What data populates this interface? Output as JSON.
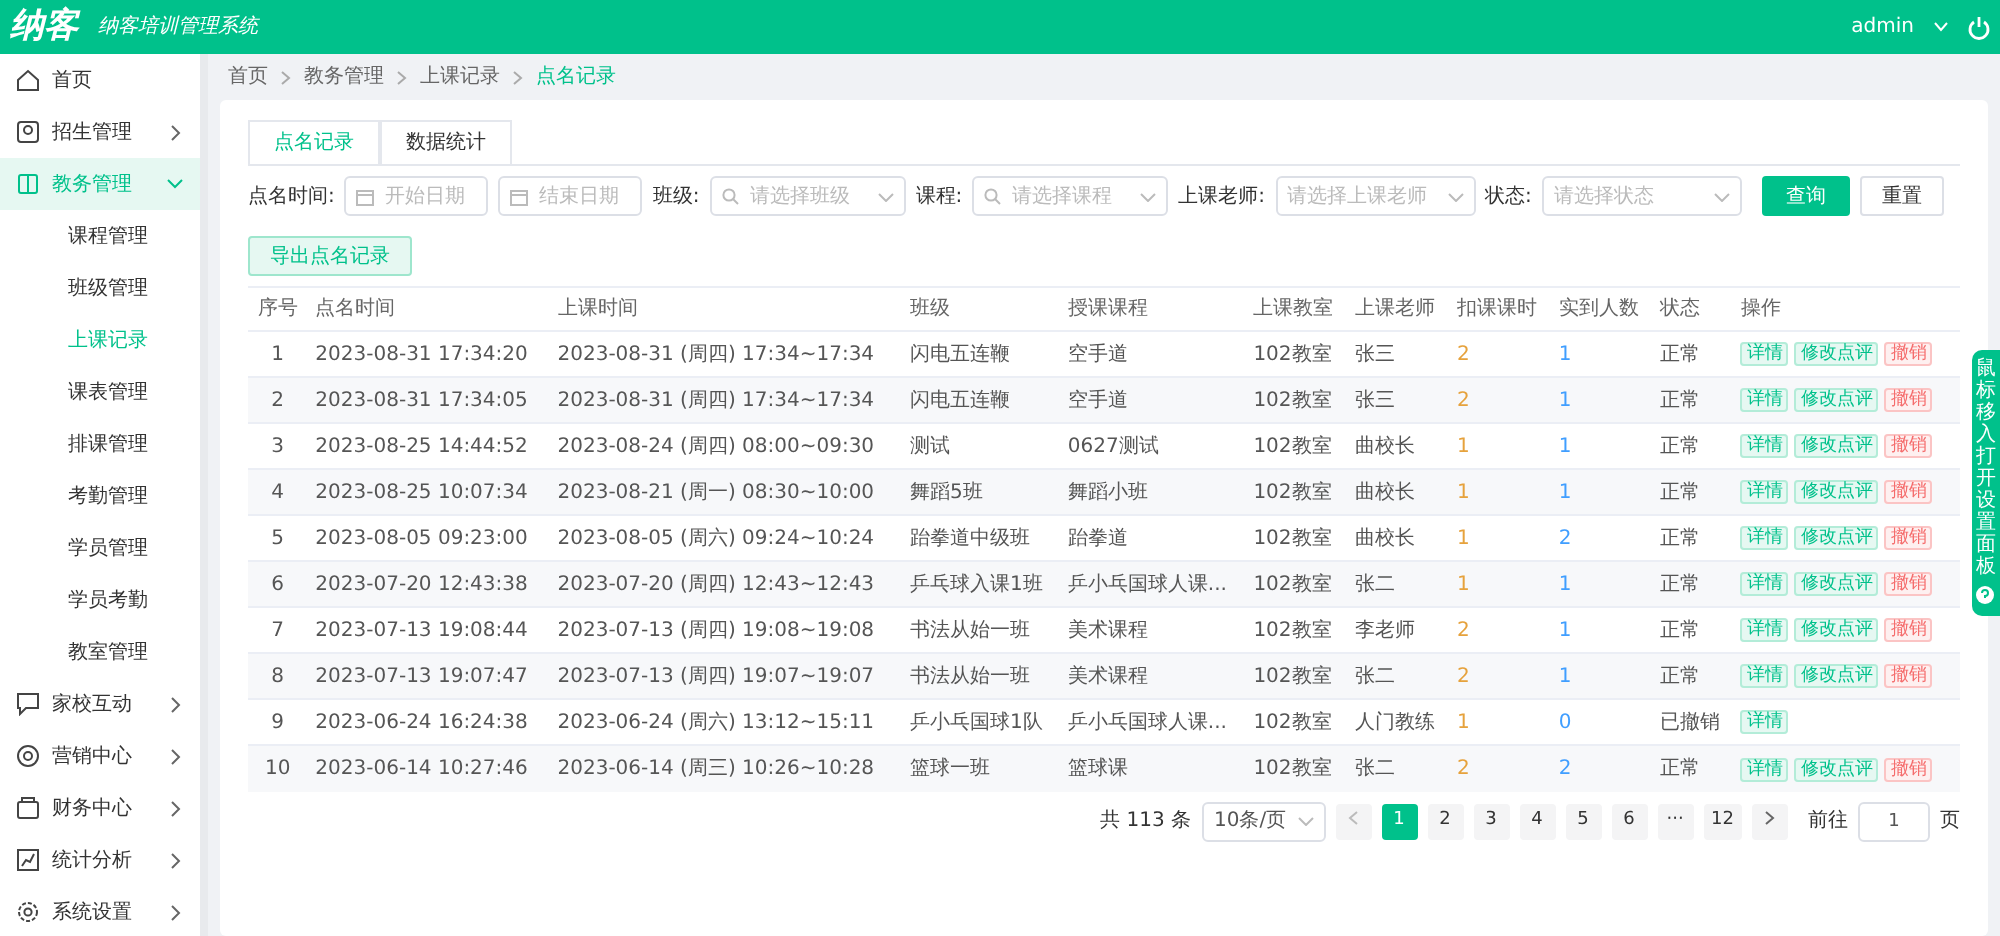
{
  "header": {
    "logo": "纳客",
    "slogan": "纳客培训管理系统",
    "user": "admin"
  },
  "sidebar": {
    "items": [
      {
        "label": "首页",
        "kind": "link"
      },
      {
        "label": "招生管理",
        "kind": "group",
        "expanded": false
      },
      {
        "label": "教务管理",
        "kind": "group",
        "expanded": true,
        "selected": true,
        "children": [
          {
            "label": "课程管理",
            "selected": false
          },
          {
            "label": "班级管理",
            "selected": false
          },
          {
            "label": "上课记录",
            "selected": true
          },
          {
            "label": "课表管理",
            "selected": false
          },
          {
            "label": "排课管理",
            "selected": false
          },
          {
            "label": "考勤管理",
            "selected": false
          },
          {
            "label": "学员管理",
            "selected": false
          },
          {
            "label": "学员考勤",
            "selected": false
          },
          {
            "label": "教室管理",
            "selected": false
          }
        ]
      },
      {
        "label": "家校互动",
        "kind": "group",
        "expanded": false
      },
      {
        "label": "营销中心",
        "kind": "group",
        "expanded": false
      },
      {
        "label": "财务中心",
        "kind": "group",
        "expanded": false
      },
      {
        "label": "统计分析",
        "kind": "group",
        "expanded": false
      },
      {
        "label": "系统设置",
        "kind": "group",
        "expanded": false
      }
    ]
  },
  "breadcrumb": [
    "首页",
    "教务管理",
    "上课记录",
    "点名记录"
  ],
  "tabs": [
    {
      "label": "点名记录",
      "selected": true
    },
    {
      "label": "数据统计",
      "selected": false
    }
  ],
  "filters": [
    {
      "label": "点名时间:",
      "kind": "date",
      "placeholders": [
        "开始日期",
        "结束日期"
      ]
    },
    {
      "label": "班级:",
      "kind": "search_select",
      "placeholder": "请选择班级"
    },
    {
      "label": "课程:",
      "kind": "search_select",
      "placeholder": "请选择课程"
    },
    {
      "label": "上课老师:",
      "kind": "select",
      "placeholder": "请选择上课老师"
    },
    {
      "label": "状态:",
      "kind": "select",
      "placeholder": "请选择状态"
    }
  ],
  "buttons": {
    "query": "查询",
    "reset": "重置",
    "export": "导出点名记录"
  },
  "table": {
    "columns": [
      "序号",
      "点名时间",
      "上课时间",
      "班级",
      "授课课程",
      "上课教室",
      "上课老师",
      "扣课课时",
      "实到人数",
      "状态",
      "操作"
    ],
    "rows": [
      {
        "cells": [
          "1",
          "2023-08-31 17:34:20",
          "2023-08-31 (周四) 17:34~17:34",
          "闪电五连鞭",
          "空手道",
          "102教室",
          "张三",
          "2",
          "1",
          "正常"
        ],
        "actions": [
          {
            "label": "详情",
            "kind": "detail"
          },
          {
            "label": "修改点评",
            "kind": "edit"
          },
          {
            "label": "撤销",
            "kind": "revoke"
          }
        ]
      },
      {
        "cells": [
          "2",
          "2023-08-31 17:34:05",
          "2023-08-31 (周四) 17:34~17:34",
          "闪电五连鞭",
          "空手道",
          "102教室",
          "张三",
          "2",
          "1",
          "正常"
        ],
        "actions": [
          {
            "label": "详情",
            "kind": "detail"
          },
          {
            "label": "修改点评",
            "kind": "edit"
          },
          {
            "label": "撤销",
            "kind": "revoke"
          }
        ]
      },
      {
        "cells": [
          "3",
          "2023-08-25 14:44:52",
          "2023-08-24 (周四) 08:00~09:30",
          "测试",
          "0627测试",
          "102教室",
          "曲校长",
          "1",
          "1",
          "正常"
        ],
        "actions": [
          {
            "label": "详情",
            "kind": "detail"
          },
          {
            "label": "修改点评",
            "kind": "edit"
          },
          {
            "label": "撤销",
            "kind": "revoke"
          }
        ]
      },
      {
        "cells": [
          "4",
          "2023-08-25 10:07:34",
          "2023-08-21 (周一) 08:30~10:00",
          "舞蹈5班",
          "舞蹈小班",
          "102教室",
          "曲校长",
          "1",
          "1",
          "正常"
        ],
        "actions": [
          {
            "label": "详情",
            "kind": "detail"
          },
          {
            "label": "修改点评",
            "kind": "edit"
          },
          {
            "label": "撤销",
            "kind": "revoke"
          }
        ]
      },
      {
        "cells": [
          "5",
          "2023-08-05 09:23:00",
          "2023-08-05 (周六) 09:24~10:24",
          "跆拳道中级班",
          "跆拳道",
          "102教室",
          "曲校长",
          "1",
          "2",
          "正常"
        ],
        "actions": [
          {
            "label": "详情",
            "kind": "detail"
          },
          {
            "label": "修改点评",
            "kind": "edit"
          },
          {
            "label": "撤销",
            "kind": "revoke"
          }
        ]
      },
      {
        "cells": [
          "6",
          "2023-07-20 12:43:38",
          "2023-07-20 (周四) 12:43~12:43",
          "乒乓球入课1班",
          "乒小乓国球人课...",
          "102教室",
          "张二",
          "1",
          "1",
          "正常"
        ],
        "actions": [
          {
            "label": "详情",
            "kind": "detail"
          },
          {
            "label": "修改点评",
            "kind": "edit"
          },
          {
            "label": "撤销",
            "kind": "revoke"
          }
        ]
      },
      {
        "cells": [
          "7",
          "2023-07-13 19:08:44",
          "2023-07-13 (周四) 19:08~19:08",
          "书法从始一班",
          "美术课程",
          "102教室",
          "李老师",
          "2",
          "1",
          "正常"
        ],
        "actions": [
          {
            "label": "详情",
            "kind": "detail"
          },
          {
            "label": "修改点评",
            "kind": "edit"
          },
          {
            "label": "撤销",
            "kind": "revoke"
          }
        ]
      },
      {
        "cells": [
          "8",
          "2023-07-13 19:07:47",
          "2023-07-13 (周四) 19:07~19:07",
          "书法从始一班",
          "美术课程",
          "102教室",
          "张二",
          "2",
          "1",
          "正常"
        ],
        "actions": [
          {
            "label": "详情",
            "kind": "detail"
          },
          {
            "label": "修改点评",
            "kind": "edit"
          },
          {
            "label": "撤销",
            "kind": "revoke"
          }
        ]
      },
      {
        "cells": [
          "9",
          "2023-06-24 16:24:38",
          "2023-06-24 (周六) 13:12~15:11",
          "乒小乓国球1队",
          "乒小乓国球人课...",
          "102教室",
          "人门教练",
          "1",
          "0",
          "已撤销"
        ],
        "actions": [
          {
            "label": "详情",
            "kind": "detail"
          }
        ]
      },
      {
        "cells": [
          "10",
          "2023-06-14 10:27:46",
          "2023-06-14 (周三) 10:26~10:28",
          "篮球一班",
          "篮球课",
          "102教室",
          "张二",
          "2",
          "2",
          "正常"
        ],
        "actions": [
          {
            "label": "详情",
            "kind": "detail"
          },
          {
            "label": "修改点评",
            "kind": "edit"
          },
          {
            "label": "撤销",
            "kind": "revoke"
          }
        ]
      }
    ]
  },
  "pagination": {
    "total": "共 113 条",
    "page_size": "10条/页",
    "pages": [
      {
        "label": "1",
        "selected": true
      },
      {
        "label": "2",
        "selected": false
      },
      {
        "label": "3",
        "selected": false
      },
      {
        "label": "4",
        "selected": false
      },
      {
        "label": "5",
        "selected": false
      },
      {
        "label": "6",
        "selected": false
      },
      {
        "label": "···",
        "selected": false
      },
      {
        "label": "12",
        "selected": false
      }
    ],
    "goto_label": "前往",
    "goto_value": "1",
    "goto_unit": "页"
  },
  "settings_tab": {
    "text": "鼠标移入打开设置面板"
  }
}
